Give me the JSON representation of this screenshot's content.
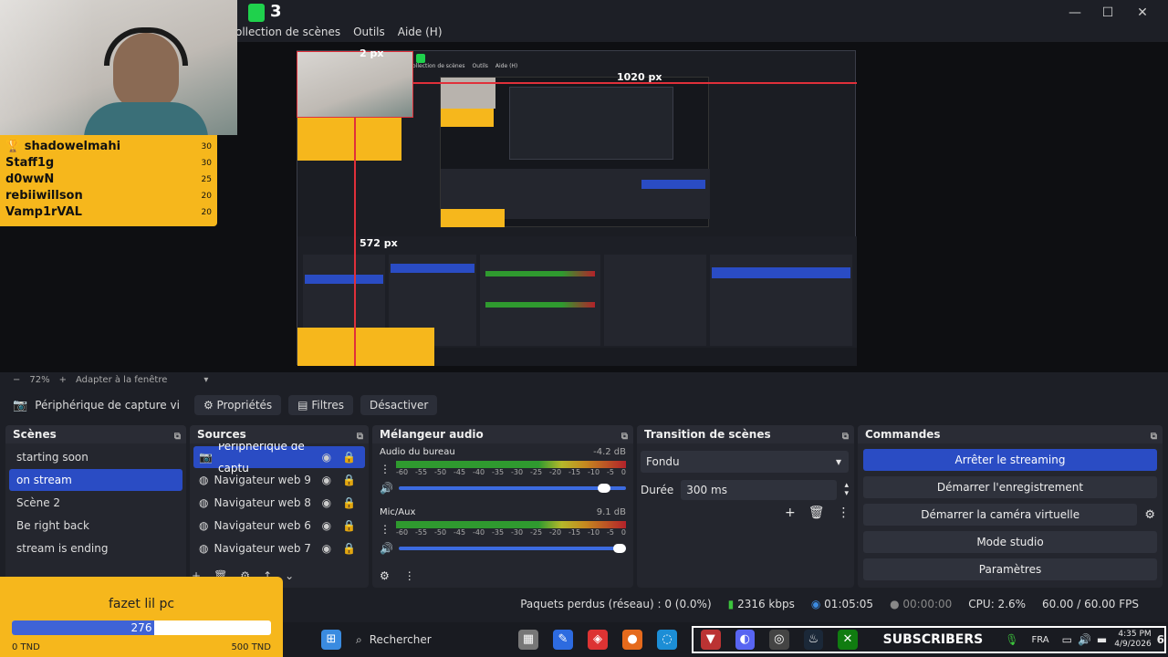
{
  "app": {
    "logo_text": "3",
    "menu": [
      "ollection de scènes",
      "Outils",
      "Aide (H)"
    ],
    "window_controls": {
      "minimize": "—",
      "maximize": "☐",
      "close": "✕"
    }
  },
  "preview": {
    "label_top": "2 px",
    "label_right": "1020 px",
    "label_left": "572 px",
    "nested_menu": [
      "ollection de scènes",
      "Outils",
      "Aide (H)"
    ]
  },
  "zoombar": {
    "minus": "−",
    "zoom": "72%",
    "plus": "+",
    "fit": "Adapter à la fenêtre"
  },
  "context": {
    "source_name": "Périphérique de capture vi",
    "properties": "Propriétés",
    "filters": "Filtres",
    "deactivate": "Désactiver"
  },
  "scenes": {
    "title": "Scènes",
    "items": [
      "starting soon",
      "on stream",
      "Scène 2",
      "Be right back",
      "stream is ending"
    ],
    "selected": "on stream"
  },
  "sources": {
    "title": "Sources",
    "items": [
      "Périphérique de captu",
      "Navigateur web 9",
      "Navigateur web 8",
      "Navigateur web 6",
      "Navigateur web 7"
    ]
  },
  "mixer": {
    "title": "Mélangeur audio",
    "channels": [
      {
        "name": "Audio du bureau",
        "db": "-4.2 dB",
        "volume": 0.93
      },
      {
        "name": "Mic/Aux",
        "db": "9.1 dB",
        "volume": 1.0
      }
    ],
    "ticks": [
      "-60",
      "-55",
      "-50",
      "-45",
      "-40",
      "-35",
      "-30",
      "-25",
      "-20",
      "-15",
      "-10",
      "-5",
      "0"
    ]
  },
  "transitions": {
    "title": "Transition de scènes",
    "selected": "Fondu",
    "duration_label": "Durée",
    "duration_value": "300 ms"
  },
  "commands": {
    "title": "Commandes",
    "buttons": [
      "Arrêter le streaming",
      "Démarrer l'enregistrement",
      "Démarrer la caméra virtuelle",
      "Mode studio",
      "Paramètres"
    ]
  },
  "status": {
    "dropped": "Paquets perdus (réseau) : 0 (0.0%)",
    "bitrate": "2316 kbps",
    "stream_time": "01:05:05",
    "rec_time": "00:00:00",
    "cpu": "CPU: 2.6%",
    "fps": "60.00 / 60.00 FPS"
  },
  "taskbar": {
    "search": "Rechercher",
    "subscribers": "SUBSCRIBERS",
    "lang": "FRA",
    "time": "4:35 PM",
    "date": "4/9/2026",
    "notif": "6"
  },
  "overlay_leaderboard": {
    "rows": [
      {
        "name": "shadowelmahi",
        "score": "30"
      },
      {
        "name": "Staff1g",
        "score": "30"
      },
      {
        "name": "d0wwN",
        "score": "25"
      },
      {
        "name": "rebiiwillson",
        "score": "20"
      },
      {
        "name": "Vamp1rVAL",
        "score": "20"
      }
    ]
  },
  "overlay_goal": {
    "title": "fazet lil pc",
    "current": "276",
    "progress": 0.55,
    "min": "0 TND",
    "max": "500 TND"
  },
  "colors": {
    "accent": "#2a4cc4",
    "overlay_yellow": "#f6b71c",
    "guide_red": "#e0303a"
  }
}
